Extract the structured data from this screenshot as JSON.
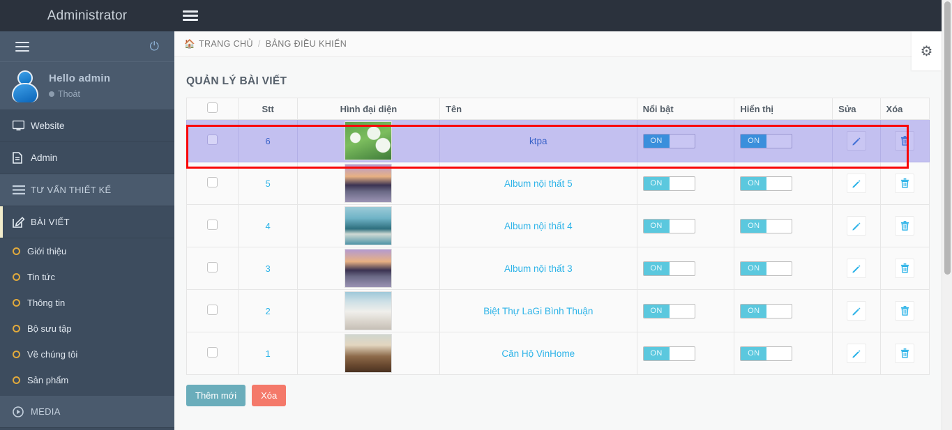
{
  "topbar": {
    "brand": "Administrator",
    "menu_toggle_icon": "hamburger-icon"
  },
  "sidebar": {
    "collapse_icon": "hamburger-icon",
    "power_icon": "power-icon",
    "profile": {
      "greeting": "Hello admin",
      "logout_label": "Thoát"
    },
    "items": [
      {
        "label": "Website",
        "icon": "monitor-icon",
        "type": "nav"
      },
      {
        "label": "Admin",
        "icon": "document-icon",
        "type": "nav"
      },
      {
        "label": "TƯ VẤN THIẾT KẾ",
        "icon": "list-icon",
        "type": "section"
      },
      {
        "label": "BÀI VIẾT",
        "icon": "edit-square-icon",
        "type": "section-active"
      }
    ],
    "sub_items": [
      {
        "label": "Giới thiệu"
      },
      {
        "label": "Tin tức"
      },
      {
        "label": "Thông tin"
      },
      {
        "label": "Bộ sưu tập"
      },
      {
        "label": "Về chúng tôi"
      },
      {
        "label": "Sản phẩm"
      }
    ],
    "media": {
      "label": "MEDIA",
      "icon": "play-circle-icon"
    }
  },
  "breadcrumb": {
    "home_icon": "home-icon",
    "home": "TRANG CHỦ",
    "separator": "/",
    "current": "BẢNG ĐIỀU KHIỂN"
  },
  "settings_button": {
    "icon": "gear-icon"
  },
  "main": {
    "page_title": "QUẢN LÝ BÀI VIẾT",
    "table": {
      "headers": [
        "",
        "Stt",
        "Hình đại diện",
        "Tên",
        "Nổi bật",
        "Hiển thị",
        "Sửa",
        "Xóa"
      ],
      "toggle_on_label": "ON",
      "edit_icon": "pencil-icon",
      "delete_icon": "trash-icon",
      "rows": [
        {
          "stt": "6",
          "name": "ktpa",
          "noi_bat": "ON",
          "hien_thi": "ON",
          "selected": true,
          "thumb": "dandelion-green"
        },
        {
          "stt": "5",
          "name": "Album nội thất 5",
          "noi_bat": "ON",
          "hien_thi": "ON",
          "selected": false,
          "thumb": "house-dusk"
        },
        {
          "stt": "4",
          "name": "Album nội thất 4",
          "noi_bat": "ON",
          "hien_thi": "ON",
          "selected": false,
          "thumb": "pool-palm"
        },
        {
          "stt": "3",
          "name": "Album nội thất 3",
          "noi_bat": "ON",
          "hien_thi": "ON",
          "selected": false,
          "thumb": "house-dusk"
        },
        {
          "stt": "2",
          "name": "Biệt Thự LaGi Bình Thuận",
          "noi_bat": "ON",
          "hien_thi": "ON",
          "selected": false,
          "thumb": "white-sofa-sea"
        },
        {
          "stt": "1",
          "name": "Căn Hộ VinHome",
          "noi_bat": "ON",
          "hien_thi": "ON",
          "selected": false,
          "thumb": "living-room-wood"
        }
      ]
    },
    "buttons": {
      "add": "Thêm mới",
      "delete": "Xóa"
    }
  },
  "colors": {
    "topbar_bg": "#2b323d",
    "sidebar_bg": "#3d4c5e",
    "link_blue": "#2db3e8",
    "toggle_on": "#5bc8de",
    "selected_row_bg": "#c3c0f0",
    "highlight_border": "#f90707",
    "btn_add": "#6aadbb",
    "btn_delete": "#f4796a",
    "accent_ring": "#e0a93c"
  }
}
